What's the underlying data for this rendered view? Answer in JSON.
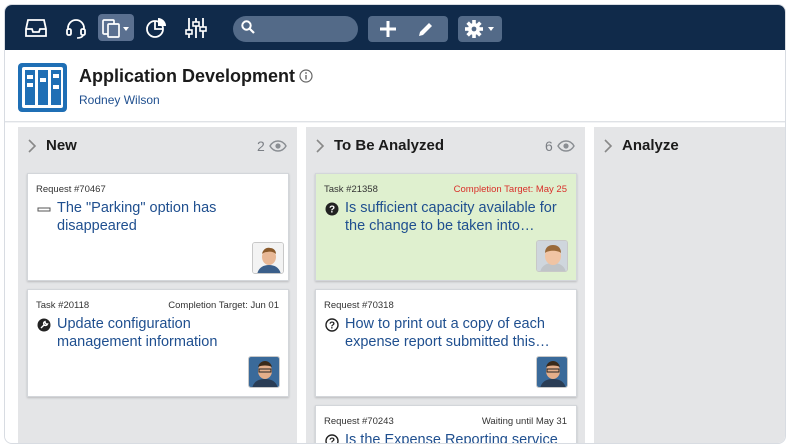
{
  "toolbar": {
    "icons": [
      "inbox-icon",
      "headset-icon",
      "documents-icon",
      "pie-chart-icon",
      "sliders-icon",
      "search-icon",
      "plus-icon",
      "pencil-icon",
      "gear-icon"
    ],
    "search_placeholder": ""
  },
  "header": {
    "title": "Application Development",
    "owner": "Rodney Wilson"
  },
  "columns": [
    {
      "title": "New",
      "count": "2",
      "cards": [
        {
          "id": "Request #70467",
          "meta": "",
          "title_lines": [
            "The \"Parking\" option has",
            "disappeared"
          ],
          "icon": "minus-icon"
        },
        {
          "id": "Task #20118",
          "meta": "Completion Target: Jun 01",
          "title_lines": [
            "Update configuration",
            "management information"
          ],
          "icon": "wrench-icon"
        }
      ]
    },
    {
      "title": "To Be Analyzed",
      "count": "6",
      "cards": [
        {
          "id": "Task #21358",
          "meta": "Completion Target: May 25",
          "title_lines": [
            "Is sufficient capacity available for",
            "the change to be taken into…"
          ],
          "icon": "question-filled-icon",
          "highlight": true
        },
        {
          "id": "Request #70318",
          "meta": "",
          "title_lines": [
            "How to print out a copy of each",
            "expense report submitted this…"
          ],
          "icon": "question-icon"
        },
        {
          "id": "Request #70243",
          "meta": "Waiting until May 31",
          "title_lines": [
            "Is the Expense Reporting service"
          ],
          "icon": "question-icon"
        }
      ]
    },
    {
      "title": "Analyze",
      "count": "",
      "cards": []
    }
  ],
  "colors": {
    "toolbar_bg": "#102a4a",
    "link": "#1f4f8f",
    "highlight_card": "#dff0cf",
    "due_red": "#d9302a"
  }
}
